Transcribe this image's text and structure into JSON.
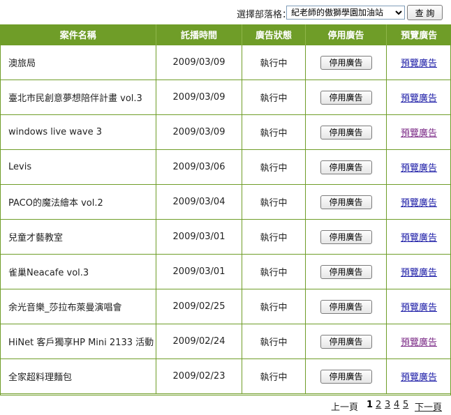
{
  "selector": {
    "label": "選擇部落格：",
    "selected": "紀老師的傲獅學園加油站",
    "button": "查 詢"
  },
  "table": {
    "headers": [
      "案件名稱",
      "託播時間",
      "廣告狀態",
      "停用廣告",
      "預覽廣告"
    ],
    "rows": [
      {
        "name": "澳旅局",
        "date": "2009/03/09",
        "status": "執行中",
        "stop": "停用廣告",
        "preview": "預覽廣告",
        "visited": false
      },
      {
        "name": "臺北市民創意夢想陪伴計畫 vol.3",
        "date": "2009/03/09",
        "status": "執行中",
        "stop": "停用廣告",
        "preview": "預覽廣告",
        "visited": false
      },
      {
        "name": "windows live wave 3",
        "date": "2009/03/09",
        "status": "執行中",
        "stop": "停用廣告",
        "preview": "預覽廣告",
        "visited": true
      },
      {
        "name": "Levis",
        "date": "2009/03/06",
        "status": "執行中",
        "stop": "停用廣告",
        "preview": "預覽廣告",
        "visited": false
      },
      {
        "name": "PACO的魔法繪本 vol.2",
        "date": "2009/03/04",
        "status": "執行中",
        "stop": "停用廣告",
        "preview": "預覽廣告",
        "visited": false
      },
      {
        "name": "兒童才藝教室",
        "date": "2009/03/01",
        "status": "執行中",
        "stop": "停用廣告",
        "preview": "預覽廣告",
        "visited": false
      },
      {
        "name": "雀巢Neacafe vol.3",
        "date": "2009/03/01",
        "status": "執行中",
        "stop": "停用廣告",
        "preview": "預覽廣告",
        "visited": false
      },
      {
        "name": "余光音樂_莎拉布萊曼演唱會",
        "date": "2009/02/25",
        "status": "執行中",
        "stop": "停用廣告",
        "preview": "預覽廣告",
        "visited": false
      },
      {
        "name": "HiNet 客戶獨享HP Mini 2133 活動",
        "date": "2009/02/24",
        "status": "執行中",
        "stop": "停用廣告",
        "preview": "預覽廣告",
        "visited": true
      },
      {
        "name": "全家超料理麵包",
        "date": "2009/02/23",
        "status": "執行中",
        "stop": "停用廣告",
        "preview": "預覽廣告",
        "visited": false
      }
    ]
  },
  "pager": {
    "prev": "上一頁",
    "current": "1",
    "pages": [
      "2",
      "3",
      "4",
      "5"
    ],
    "next": "下一頁"
  },
  "colors": {
    "header_bg": "#6f9d28",
    "link": "#1a1aa6",
    "visited_link": "#7b2a86"
  }
}
